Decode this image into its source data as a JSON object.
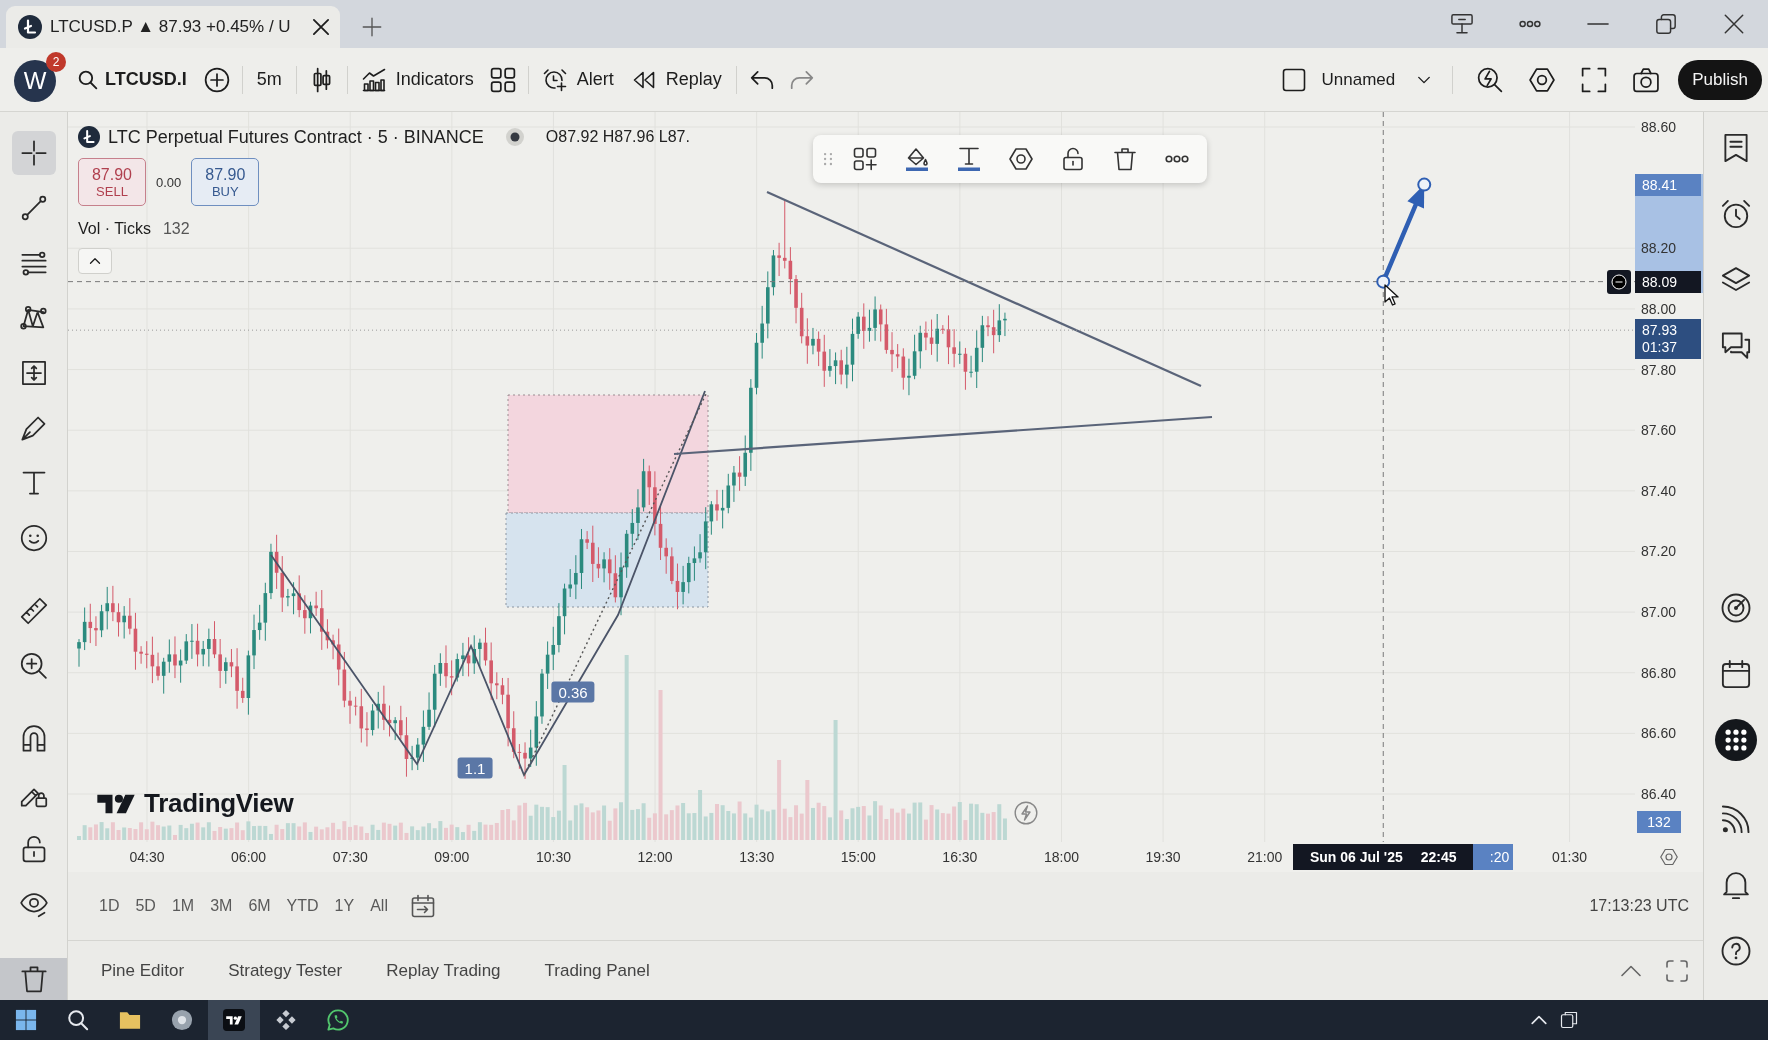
{
  "browser_tab": {
    "title": "LTCUSD.P ▲ 87.93 +0.45% / U"
  },
  "toolbar": {
    "left": [
      {
        "kind": "avatar",
        "label": "W",
        "badge": "2"
      },
      {
        "kind": "symbol",
        "label": "LTCUSD.I"
      },
      {
        "kind": "compare"
      },
      {
        "kind": "interval",
        "label": "5m"
      },
      {
        "kind": "chart-style"
      },
      {
        "kind": "indicators",
        "label": "Indicators"
      },
      {
        "kind": "templates"
      },
      {
        "kind": "alert",
        "label": "Alert"
      },
      {
        "kind": "replay",
        "label": "Replay"
      },
      {
        "kind": "undo"
      },
      {
        "kind": "redo"
      }
    ],
    "right": [
      {
        "kind": "layout",
        "label": "Unnamed"
      },
      {
        "kind": "quick-search"
      },
      {
        "kind": "settings"
      },
      {
        "kind": "fullscreen"
      },
      {
        "kind": "snapshot"
      },
      {
        "kind": "publish",
        "label": "Publish"
      }
    ]
  },
  "drawing_tools": [
    {
      "tools": [
        {
          "kind": "crosshair",
          "selected": true
        },
        {
          "kind": "trend-line",
          "selected": false
        },
        {
          "kind": "fib",
          "selected": false
        },
        {
          "kind": "pattern",
          "selected": false
        },
        {
          "kind": "projection",
          "selected": false
        },
        {
          "kind": "brush",
          "selected": false
        },
        {
          "kind": "text",
          "selected": false
        },
        {
          "kind": "emoji",
          "selected": false
        }
      ]
    },
    {
      "tools": [
        {
          "kind": "measure",
          "selected": false
        },
        {
          "kind": "zoom",
          "selected": false
        }
      ]
    },
    {
      "tools": [
        {
          "kind": "magnet",
          "selected": false
        },
        {
          "kind": "lock-drawing",
          "selected": false
        },
        {
          "kind": "lock-all",
          "selected": false
        },
        {
          "kind": "hide",
          "selected": false
        }
      ]
    },
    {
      "tools": [
        {
          "kind": "remove",
          "selected": true
        }
      ]
    }
  ],
  "chart": {
    "legend": {
      "title": "LTC Perpetual Futures Contract · 5 · BINANCE",
      "ohlc": "O87.92 H87.96 L87.",
      "sell": {
        "price": "87.90",
        "label": "SELL"
      },
      "spread": "0.00",
      "buy": {
        "price": "87.90",
        "label": "BUY"
      },
      "volume": {
        "name": "Vol · Ticks",
        "value": "132"
      }
    },
    "drawing_labels": [
      "1.1",
      "0.36"
    ],
    "logo": "TradingView",
    "price_axis": {
      "ticks": [
        "88.60",
        "88.20",
        "88.00",
        "87.80",
        "87.60",
        "87.40",
        "87.20",
        "87.00",
        "86.80",
        "86.60",
        "86.40"
      ],
      "labels": [
        {
          "kind": "drawing",
          "text": "88.41"
        },
        {
          "kind": "crosshair",
          "text": "88.09"
        },
        {
          "kind": "last-price",
          "text": "87.93",
          "countdown": "01:37"
        },
        {
          "kind": "volume",
          "text": "132"
        }
      ]
    },
    "time_axis": {
      "ticks": [
        "04:30",
        "06:00",
        "07:30",
        "09:00",
        "10:30",
        "12:00",
        "13:30",
        "15:00",
        "16:30",
        "18:00",
        "19:30",
        "21:00",
        "01:30"
      ],
      "crosshair": {
        "date": "Sun 06 Jul '25",
        "time": "22:45"
      },
      "drawing_label": ":20"
    }
  },
  "range_bar": {
    "ranges": [
      "1D",
      "5D",
      "1M",
      "3M",
      "6M",
      "YTD",
      "1Y",
      "All"
    ],
    "clock": "17:13:23 UTC"
  },
  "bottom_tabs": [
    "Pine Editor",
    "Strategy Tester",
    "Replay Trading",
    "Trading Panel"
  ],
  "taskbar": {
    "apps": [
      {
        "kind": "start",
        "selected": false
      },
      {
        "kind": "search",
        "selected": false
      },
      {
        "kind": "files",
        "selected": false
      },
      {
        "kind": "browser",
        "selected": false
      },
      {
        "kind": "trading-app",
        "selected": true
      },
      {
        "kind": "exchange-app",
        "selected": false
      },
      {
        "kind": "messenger",
        "selected": false
      }
    ]
  }
}
